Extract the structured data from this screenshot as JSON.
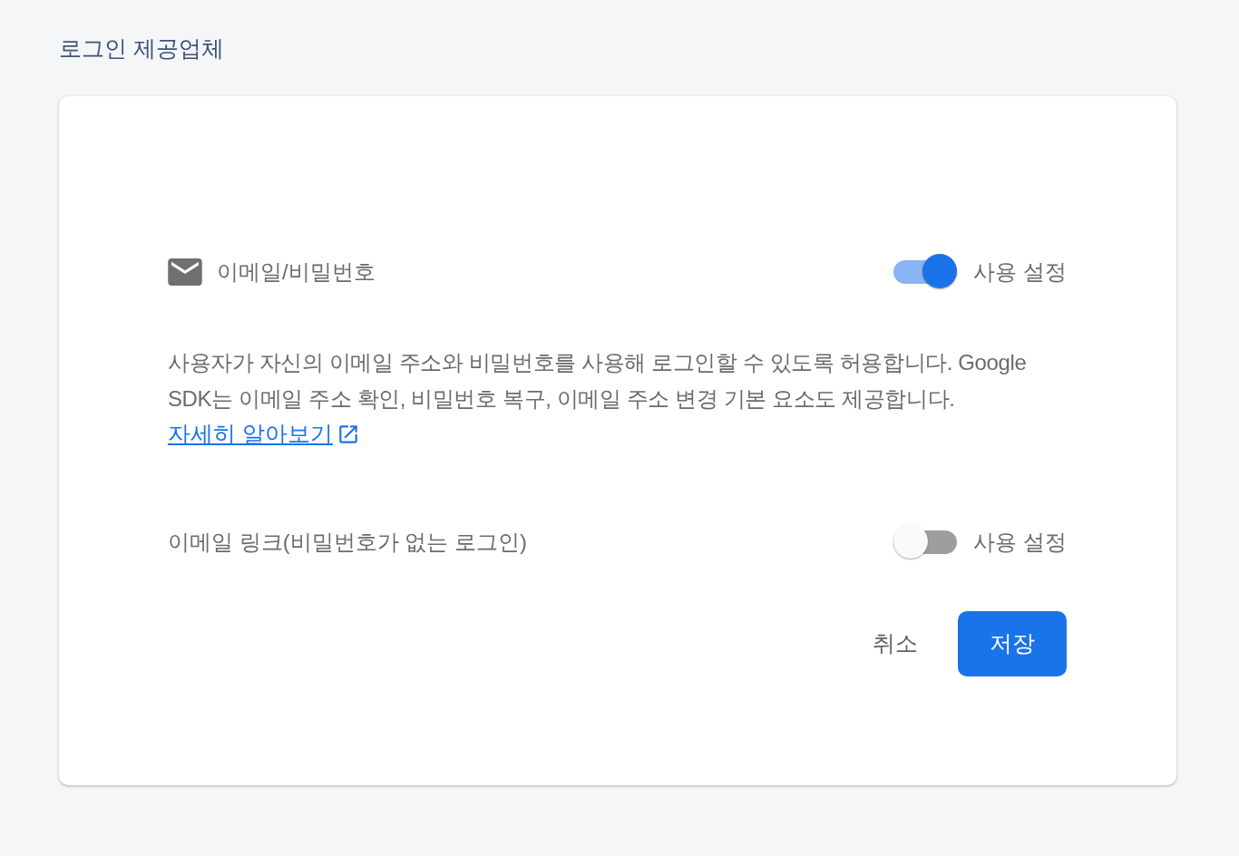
{
  "page_title": "로그인 제공업체",
  "provider": {
    "name": "이메일/비밀번호",
    "toggle": {
      "label": "사용 설정",
      "on": true
    },
    "description": "사용자가 자신의 이메일 주소와 비밀번호를 사용해 로그인할 수 있도록 허용합니다. Google SDK는 이메일 주소 확인, 비밀번호 복구, 이메일 주소 변경 기본 요소도 제공합니다.",
    "learn_more_link": "자세히 알아보기"
  },
  "email_link": {
    "name": "이메일 링크(비밀번호가 없는 로그인)",
    "toggle": {
      "label": "사용 설정",
      "on": false
    }
  },
  "buttons": [
    {
      "label": "취소",
      "kind": "text"
    },
    {
      "label": "저장",
      "kind": "primary"
    }
  ]
}
